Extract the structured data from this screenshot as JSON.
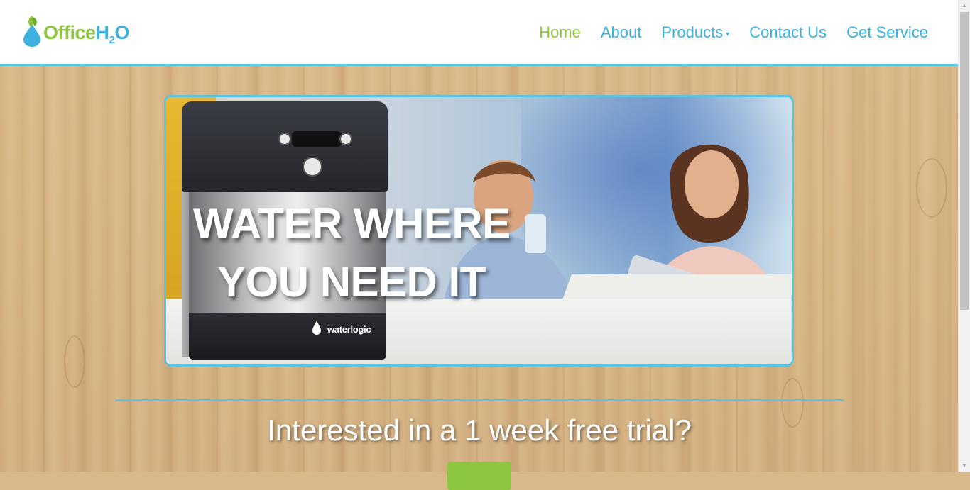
{
  "brand": {
    "logo_office": "Office",
    "logo_h": "H",
    "logo_2": "2",
    "logo_o": "O"
  },
  "nav": {
    "items": [
      {
        "label": "Home",
        "active": true
      },
      {
        "label": "About"
      },
      {
        "label": "Products",
        "has_dropdown": true
      },
      {
        "label": "Contact Us"
      },
      {
        "label": "Get Service"
      }
    ]
  },
  "hero": {
    "headline_line1": "WATER WHERE",
    "headline_line2": "YOU NEED IT",
    "product_brand": "waterlogic"
  },
  "cta": {
    "text": "Interested in a 1 week free trial?"
  },
  "colors": {
    "accent_blue": "#5bc4e3",
    "brand_green": "#8dc63f",
    "link_blue": "#3eb1e0"
  }
}
